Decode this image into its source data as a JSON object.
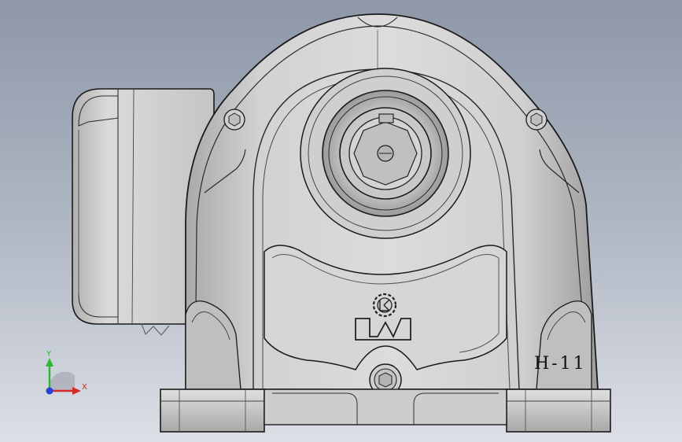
{
  "viewport": {
    "background_top": "#8d97a8",
    "background_bottom": "#dcdfe5"
  },
  "model": {
    "part_label": "H-11",
    "logo": "lk-gear-logo",
    "body_color": "#c9c9c9",
    "edge_color": "#1a1a1a"
  },
  "triad": {
    "y_label": "Y",
    "x_label": "X",
    "y_color": "#2fb52f",
    "x_color": "#d42a2a",
    "z_color": "#2b3fd8"
  }
}
